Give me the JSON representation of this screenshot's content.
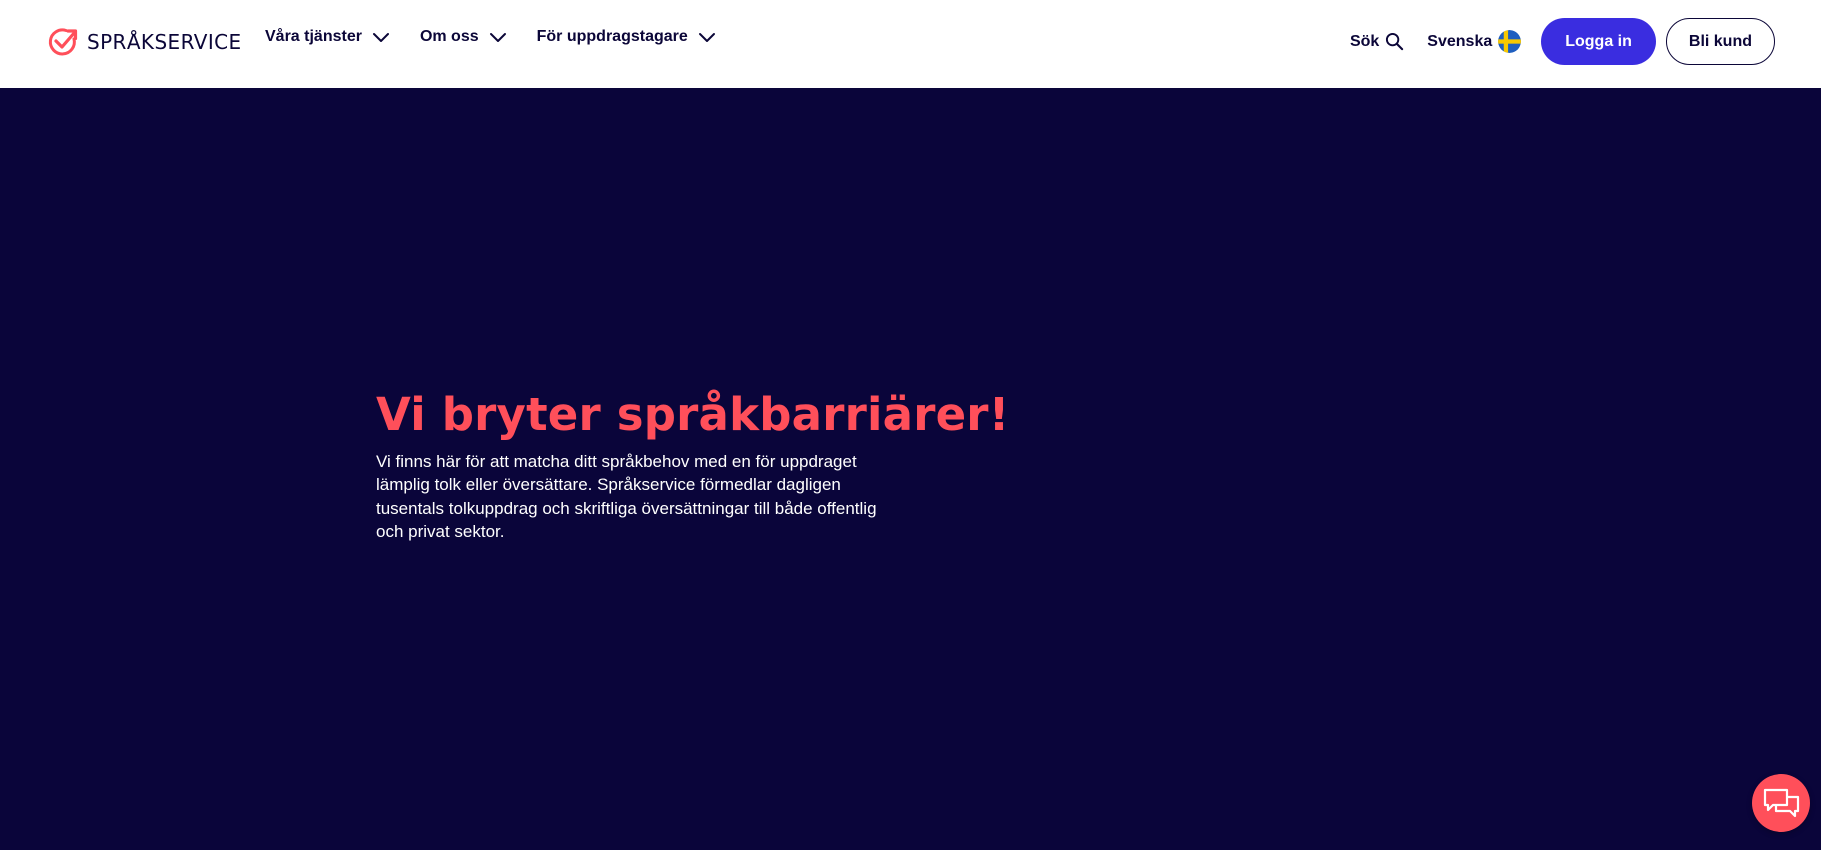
{
  "header": {
    "logo_text": "SPRÅKSERVICE",
    "nav": [
      {
        "label": "Våra tjänster"
      },
      {
        "label": "Om oss"
      },
      {
        "label": "För uppdragstagare"
      }
    ],
    "search_label": "Sök",
    "language_label": "Svenska",
    "login_label": "Logga in",
    "become_customer_label": "Bli kund"
  },
  "hero": {
    "title": "Vi bryter språkbarriärer!",
    "text": "Vi finns här för att matcha ditt språkbehov med en för uppdraget lämplig tolk eller översättare. Språkservice förmedlar dagligen tusentals tolkuppdrag och skriftliga översättningar till både offentlig och privat sektor."
  },
  "icons": {
    "logo": "check-arrow-circle-icon",
    "search": "search-icon",
    "flag": "swedish-flag-icon",
    "chevron": "chevron-down-icon",
    "chat": "chat-bubbles-icon"
  },
  "colors": {
    "primary_navy": "#0a053a",
    "accent_coral": "#ff4f5a",
    "button_blue": "#3a2de0"
  }
}
